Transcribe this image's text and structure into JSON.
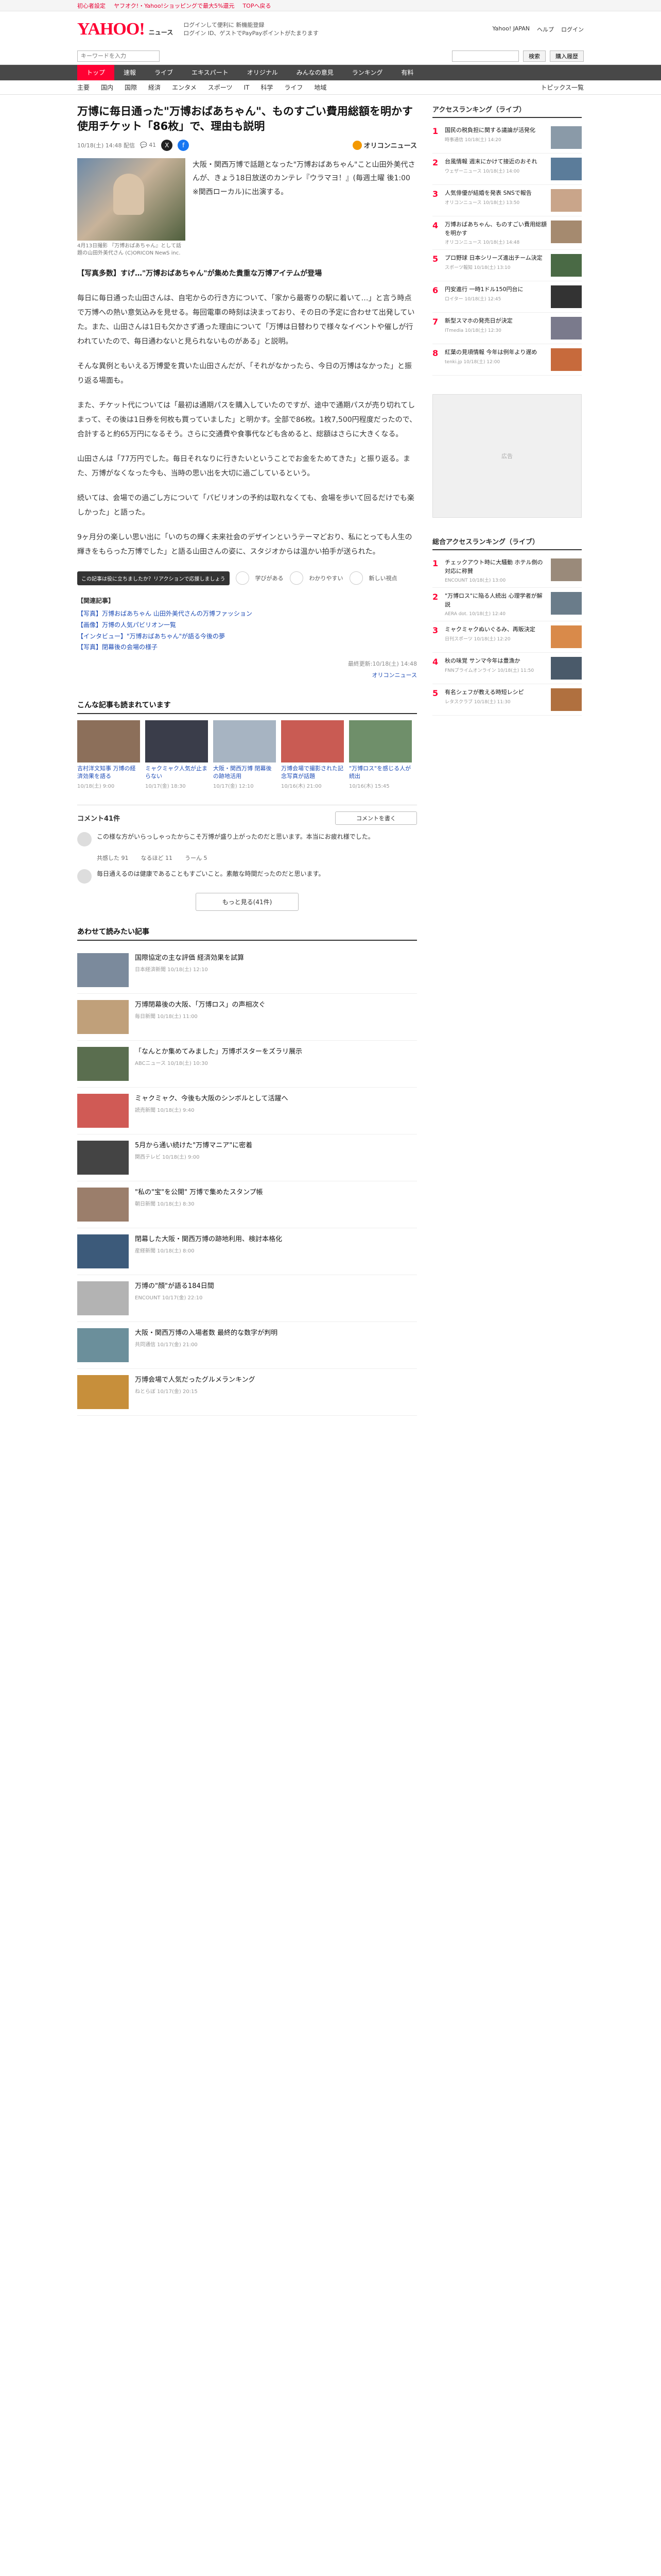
{
  "top_strip": {
    "items": [
      "初心者設定",
      "ヤフオク!・Yahoo!ショッピングで最大5%還元",
      "TOPへ戻る"
    ]
  },
  "header": {
    "logo": "YAHOO!",
    "logo_sub": "ニュース",
    "info_line1": "ログインして便利に 新機能登録",
    "info_line2": "ログイン ID、ゲストでPayPayポイントがたまります",
    "right_links": [
      "Yahoo! JAPAN",
      "ヘルプ",
      "ログイン"
    ]
  },
  "search": {
    "placeholder": "キーワードを入力",
    "button": "検索",
    "side_button": "購入履歴"
  },
  "nav": {
    "items": [
      "トップ",
      "速報",
      "ライブ",
      "エキスパート",
      "オリジナル",
      "みんなの意見",
      "ランキング",
      "有料"
    ]
  },
  "subnav": {
    "items": [
      "主要",
      "国内",
      "国際",
      "経済",
      "エンタメ",
      "スポーツ",
      "IT",
      "科学",
      "ライフ",
      "地域"
    ],
    "more": "トピックス一覧"
  },
  "article": {
    "title": "万博に毎日通った\"万博おばあちゃん\"、ものすごい費用総額を明かす　使用チケット「86枚」で、理由も説明",
    "date": "10/18(土) 14:48 配信",
    "comment_count": "41",
    "provider": "オリコンニュース",
    "lead_caption": "4月13日撮影 『万博おばあちゃん』として話題の山田外美代さん (C)ORICON NewS inc.",
    "lead_text": "大阪・関西万博で話題となった\"万博おばあちゃん\"こと山田外美代さんが、きょう18日放送のカンテレ『ウラマヨ！』(毎週土曜 後1:00 ※関西ローカル)に出演する。",
    "tag": "【写真多数】すげ…\"万博おばあちゃん\"が集めた貴重な万博アイテムが登場",
    "paragraphs": [
      "毎日に毎日通った山田さんは、自宅からの行き方について、「家から最寄りの駅に着いて…」と言う時点で万博への熱い意気込みを見せる。毎回電車の時刻は決まっており、その日の予定に合わせて出発していた。また、山田さんは1日も欠かさず通った理由について「万博は日替わりで様々なイベントや催しが行われていたので、毎日通わないと見られないものがある」と説明。",
      "そんな異例ともいえる万博愛を貫いた山田さんだが、「それがなかったら、今日の万博はなかった」と振り返る場面も。",
      "また、チケット代については「最初は通期パスを購入していたのですが、途中で通期パスが売り切れてしまって、その後は1日券を何枚も買っていました」と明かす。全部で86枚。1枚7,500円程度だったので、合計すると約65万円になるそう。さらに交通費や食事代なども含めると、総額はさらに大きくなる。",
      "山田さんは「77万円でした。毎日それなりに行きたいということでお金をためてきた」と振り返る。また、万博がなくなった今も、当時の思い出を大切に過ごしているという。",
      "続いては、会場での過ごし方について「パビリオンの予約は取れなくても、会場を歩いて回るだけでも楽しかった」と語った。",
      "9ヶ月分の楽しい思い出に「いのちの輝く未来社会のデザインというテーマどおり、私にとっても人生の輝きをもらった万博でした」と語る山田さんの姿に、スタジオからは温かい拍手が送られた。"
    ],
    "tooltip": "この記事は役に立ちましたか？リアクションで応援しましょう",
    "reactions": [
      "学びがある",
      "わかりやすい",
      "新しい視点"
    ],
    "related_hd": "【関連記事】",
    "related": [
      "【写真】万博おばあちゃん 山田外美代さんの万博ファッション",
      "【画像】万博の人気パビリオン一覧",
      "【インタビュー】\"万博おばあちゃん\"が語る今後の夢",
      "【写真】閉幕後の会場の様子"
    ],
    "updated": "最終更新:10/18(土) 14:48",
    "pager": "オリコンニュース"
  },
  "cards_section": {
    "title": "こんな記事も読まれています",
    "cards": [
      {
        "title": "吉村洋文知事 万博の経済効果を語る",
        "date": "10/18(土) 9:00"
      },
      {
        "title": "ミャクミャク人気が止まらない",
        "date": "10/17(金) 18:30"
      },
      {
        "title": "大阪・関西万博 閉幕後の跡地活用",
        "date": "10/17(金) 12:10"
      },
      {
        "title": "万博会場で撮影された記念写真が話題",
        "date": "10/16(木) 21:00"
      },
      {
        "title": "\"万博ロス\"を感じる人が続出",
        "date": "10/16(木) 15:45"
      }
    ]
  },
  "comments": {
    "title": "コメント41件",
    "write": "コメントを書く",
    "items": [
      {
        "text": "この様な方がいらっしゃったからこそ万博が盛り上がったのだと思います。本当にお疲れ様でした。"
      },
      {
        "text": "毎日通えるのは健康であることもすごいこと。素敵な時間だったのだと思います。"
      }
    ],
    "votes": [
      "共感した 91",
      "なるほど 11",
      "うーん 5"
    ],
    "more": "もっと見る(41件)"
  },
  "recommend_section": {
    "title": "あわせて読みたい記事",
    "items": [
      {
        "title": "国際協定の主な評価 経済効果を試算",
        "source": "日本経済新聞 10/18(土) 12:10"
      },
      {
        "title": "万博閉幕後の大阪、「万博ロス」の声相次ぐ",
        "source": "毎日新聞 10/18(土) 11:00"
      },
      {
        "title": "「なんとか集めてみました」万博ポスターをズラリ展示",
        "source": "ABCニュース 10/18(土) 10:30"
      },
      {
        "title": "ミャクミャク、今後も大阪のシンボルとして活躍へ",
        "source": "読売新聞 10/18(土) 9:40"
      },
      {
        "title": "5月から通い続けた\"万博マニア\"に密着",
        "source": "関西テレビ 10/18(土) 9:00"
      },
      {
        "title": "\"私の\"宝\"を公開\" 万博で集めたスタンプ帳",
        "source": "朝日新聞 10/18(土) 8:30"
      },
      {
        "title": "閉幕した大阪・関西万博の跡地利用、検討本格化",
        "source": "産経新聞 10/18(土) 8:00"
      },
      {
        "title": "万博の\"顔\"が語る184日間",
        "source": "ENCOUNT 10/17(金) 22:10"
      },
      {
        "title": "大阪・関西万博の入場者数 最終的な数字が判明",
        "source": "共同通信 10/17(金) 21:00"
      },
      {
        "title": "万博会場で人気だったグルメランキング",
        "source": "ねとらぼ 10/17(金) 20:15"
      }
    ]
  },
  "sidebar": {
    "access_ranking_title": "アクセスランキング（ライブ）",
    "access_ranking": [
      {
        "title": "国民の税負担に関する議論が活発化",
        "src": "時事通信 10/18(土) 14:20"
      },
      {
        "title": "台風情報 週末にかけて接近のおそれ",
        "src": "ウェザーニュース 10/18(土) 14:00"
      },
      {
        "title": "人気俳優が結婚を発表 SNSで報告",
        "src": "オリコンニュース 10/18(土) 13:50"
      },
      {
        "title": "万博おばあちゃん、ものすごい費用総額を明かす",
        "src": "オリコンニュース 10/18(土) 14:48"
      },
      {
        "title": "プロ野球 日本シリーズ進出チーム決定",
        "src": "スポーツ報知 10/18(土) 13:10"
      },
      {
        "title": "円安進行 一時1ドル150円台に",
        "src": "ロイター 10/18(土) 12:45"
      },
      {
        "title": "新型スマホの発売日が決定",
        "src": "ITmedia 10/18(土) 12:30"
      },
      {
        "title": "紅葉の見頃情報 今年は例年より遅め",
        "src": "tenki.jp 10/18(土) 12:00"
      }
    ],
    "news_ranking_title": "総合アクセスランキング（ライブ）",
    "news_ranking": [
      {
        "title": "チェックアウト時に大騒動 ホテル側の対応に称賛",
        "src": "ENCOUNT 10/18(土) 13:00"
      },
      {
        "title": "\"万博ロス\"に陥る人続出 心理学者が解説",
        "src": "AERA dot. 10/18(土) 12:40"
      },
      {
        "title": "ミャクミャクぬいぐるみ、再販決定",
        "src": "日刊スポーツ 10/18(土) 12:20"
      },
      {
        "title": "秋の味覚 サンマ今年は豊漁か",
        "src": "FNNプライムオンライン 10/18(土) 11:50"
      },
      {
        "title": "有名シェフが教える時短レシピ",
        "src": "レタスクラブ 10/18(土) 11:30"
      }
    ],
    "ad_label": "広告"
  }
}
